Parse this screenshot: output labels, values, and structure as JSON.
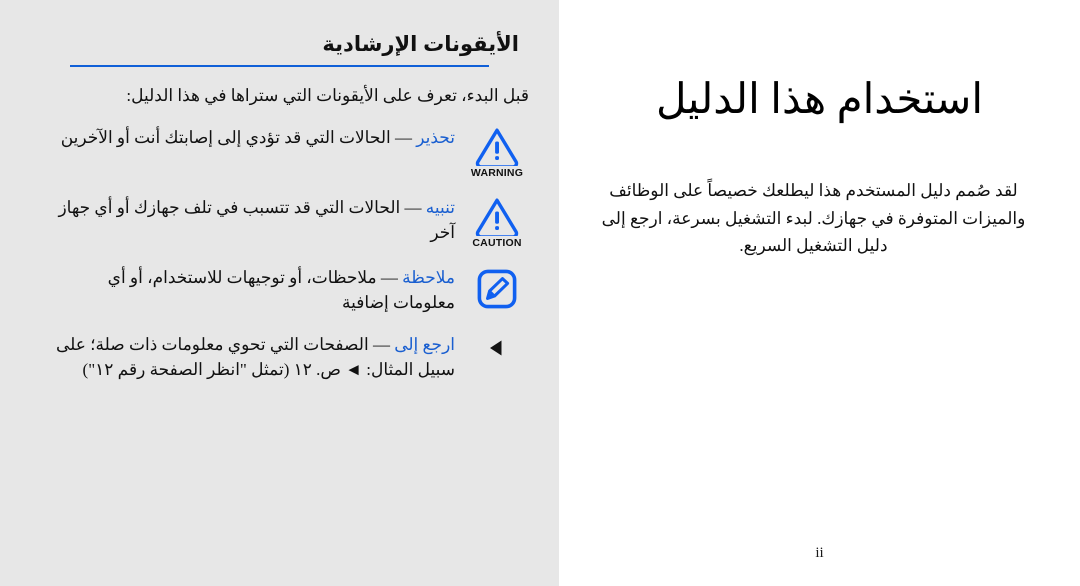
{
  "page": {
    "folio": "ii",
    "accent_blue": "#1060d8",
    "term_blue": "#1a5fd0",
    "panel_gray": "#e7e7e7",
    "page_white": "#ffffff"
  },
  "icons_section": {
    "heading": "الأيقونات الإرشادية",
    "intro": "قبل البدء، تعرف على الأيقونات التي ستراها في هذا الدليل:",
    "rows": [
      {
        "icon_name": "warning-triangle-icon",
        "icon_label": "WARNING",
        "term": "تحذير",
        "dash": " — ",
        "description": "الحالات التي قد تؤدي إلى إصابتك أنت أو الآخرين"
      },
      {
        "icon_name": "caution-triangle-icon",
        "icon_label": "CAUTION",
        "term": "تنبيه",
        "dash": " — ",
        "description": "الحالات التي قد تتسبب في تلف جهازك أو أي جهاز آخر"
      },
      {
        "icon_name": "note-pencil-icon",
        "icon_label": "",
        "term": "ملاحظة",
        "dash": " — ",
        "description": "ملاحظات، أو توجيهات للاستخدام، أو أي معلومات إضافية"
      },
      {
        "icon_name": "refer-to-arrow-icon",
        "icon_label": "",
        "term": "ارجع إلى",
        "dash": " — ",
        "description": "الصفحات التي تحوي معلومات ذات صلة؛ على سبيل المثال: ◄ ص. ١٢ (تمثل \"انظر الصفحة رقم ١٢\")"
      }
    ]
  },
  "chapter": {
    "title": "استخدام هذا الدليل",
    "body": "لقد صُمم دليل المستخدم هذا ليطلعك خصيصاً على الوظائف والميزات المتوفرة في جهازك. لبدء التشغيل بسرعة، ارجع إلى دليل التشغيل السريع."
  }
}
